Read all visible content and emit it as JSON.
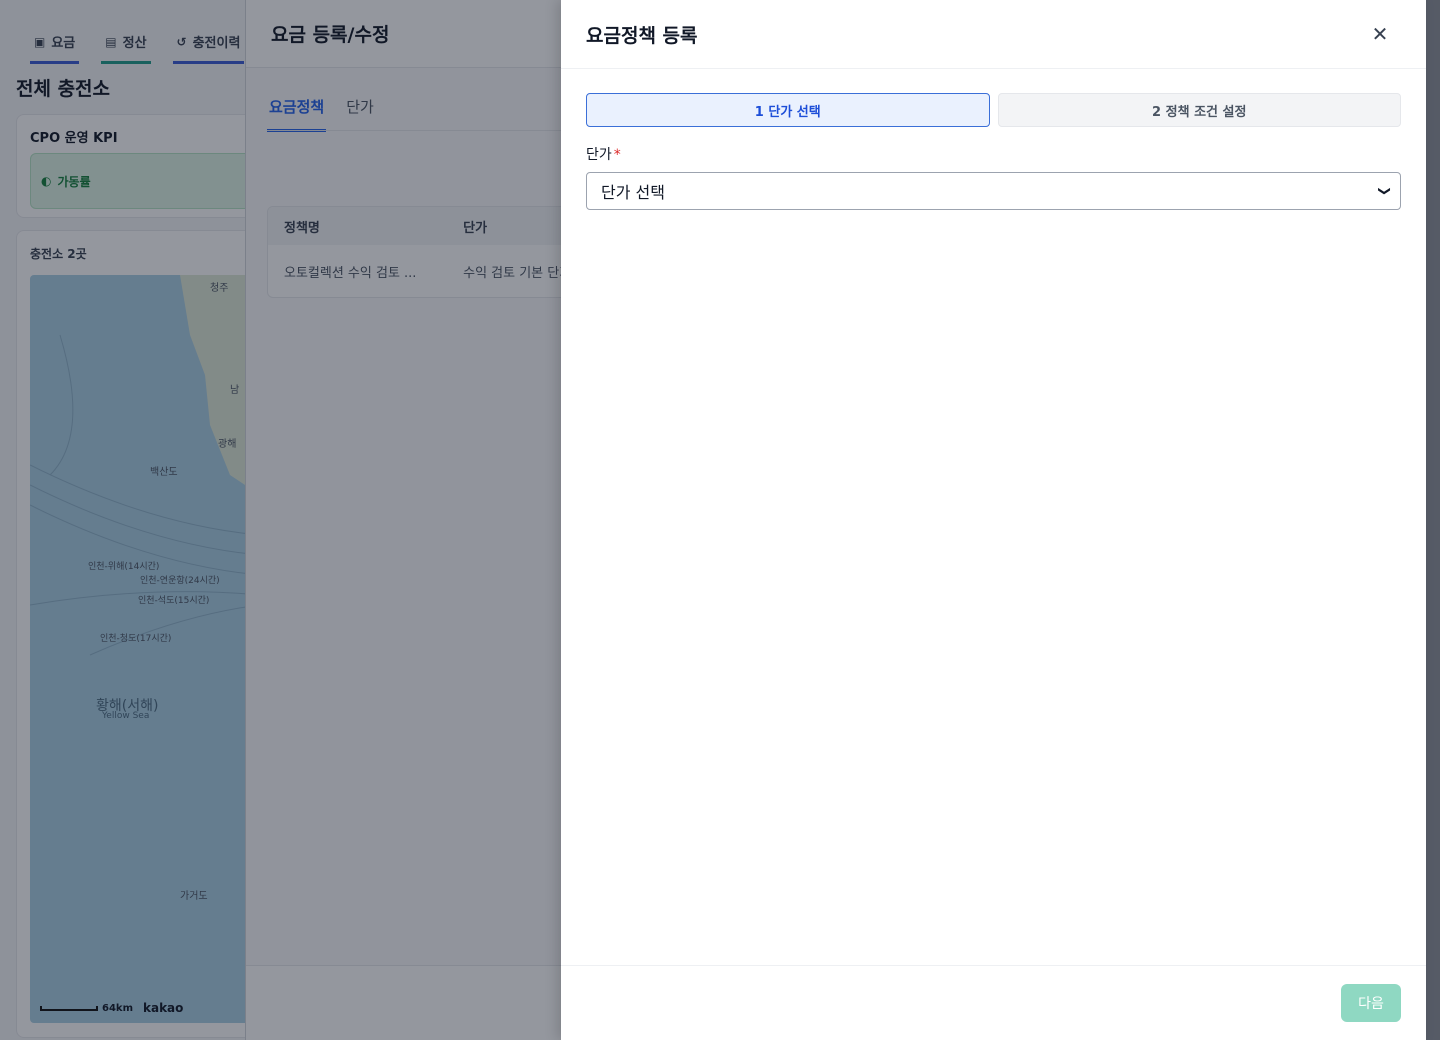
{
  "background": {
    "top_tabs": [
      {
        "label": "요금",
        "icon": "document-icon"
      },
      {
        "label": "정산",
        "icon": "wallet-icon"
      },
      {
        "label": "충전이력",
        "icon": "history-icon"
      }
    ],
    "page_title": "전체 충전소",
    "kpi": {
      "title": "CPO 운영 KPI",
      "chip_label": "가동률"
    },
    "map": {
      "count_label": "충전소 2곳",
      "places": [
        "청주",
        "남",
        "광해",
        "백산도"
      ],
      "routes": [
        "인천-위해(14시간)",
        "인천-연운항(24시간)",
        "인천-석도(15시간)",
        "인천-청도(17시간)"
      ],
      "sea_name": "황해(서해)",
      "sea_name_en": "Yellow Sea",
      "island": "가거도",
      "scale": "64km",
      "provider": "kakao"
    }
  },
  "middle_panel": {
    "title": "요금 등록/수정",
    "tabs": [
      "요금정책",
      "단가"
    ],
    "table": {
      "headers": [
        "정책명",
        "단가"
      ],
      "rows": [
        [
          "오토컬렉션 수익 검토 ...",
          "수익 검토 기본 단가"
        ]
      ]
    }
  },
  "drawer": {
    "title": "요금정책 등록",
    "close_icon": "close-icon",
    "steps": [
      "1 단가 선택",
      "2 정책 조건 설정"
    ],
    "field_label": "단가",
    "required_mark": "*",
    "select_value": "단가 선택",
    "next_label": "다음",
    "colors": {
      "accent": "#1d4ed8",
      "next_disabled": "#8fd8c2",
      "required": "#dc2626"
    }
  }
}
